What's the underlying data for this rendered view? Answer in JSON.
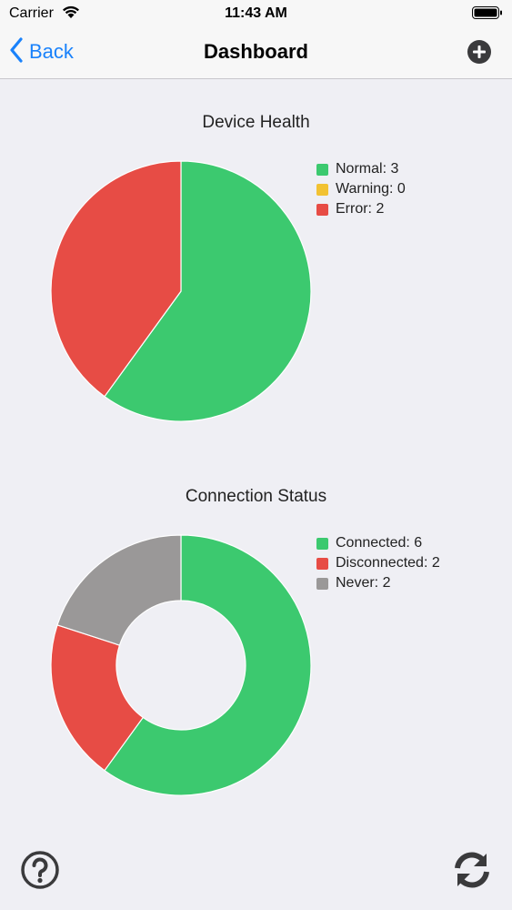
{
  "status_bar": {
    "carrier": "Carrier",
    "time": "11:43 AM"
  },
  "nav": {
    "back_label": "Back",
    "title": "Dashboard"
  },
  "colors": {
    "accent": "#1a82fb",
    "green": "#3cc96f",
    "yellow": "#f2c232",
    "red": "#e74c45",
    "gray": "#9a9898"
  },
  "chart_data": [
    {
      "type": "pie",
      "title": "Device Health",
      "categories": [
        "Normal",
        "Warning",
        "Error"
      ],
      "values": [
        3,
        0,
        2
      ],
      "legend_labels": [
        "Normal: 3",
        "Warning: 0",
        "Error: 2"
      ],
      "colors": [
        "#3cc96f",
        "#f2c232",
        "#e74c45"
      ],
      "legend": "top-right"
    },
    {
      "type": "pie",
      "donut": true,
      "title": "Connection Status",
      "categories": [
        "Connected",
        "Disconnected",
        "Never"
      ],
      "values": [
        6,
        2,
        2
      ],
      "legend_labels": [
        "Connected: 6",
        "Disconnected: 2",
        "Never: 2"
      ],
      "colors": [
        "#3cc96f",
        "#e74c45",
        "#9a9898"
      ],
      "legend": "top-right"
    }
  ],
  "icons": {
    "add": "plus-circle-icon",
    "help": "question-circle-icon",
    "refresh": "refresh-icon"
  }
}
